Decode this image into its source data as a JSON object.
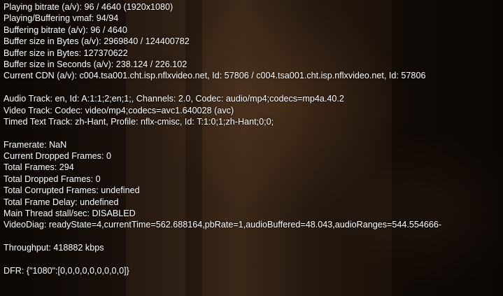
{
  "stats": {
    "playback": [
      "Playing bitrate (a/v): 96 / 4640 (1920x1080)",
      "Playing/Buffering vmaf: 94/94",
      "Buffering bitrate (a/v): 96 / 4640",
      "Buffer size in Bytes (a/v): 2969840 / 124400782",
      "Buffer size in Bytes: 127370622",
      "Buffer size in Seconds (a/v): 238.124 / 226.102",
      "Current CDN (a/v): c004.tsa001.cht.isp.nflxvideo.net, Id: 57806 / c004.tsa001.cht.isp.nflxvideo.net, Id: 57806"
    ],
    "tracks": [
      "Audio Track: en, Id: A:1:1;2;en;1;, Channels: 2.0, Codec: audio/mp4;codecs=mp4a.40.2",
      "Video Track: Codec: video/mp4;codecs=avc1.640028 (avc)",
      "Timed Text Track: zh-Hant, Profile: nflx-cmisc, Id: T:1:0;1;zh-Hant;0;0;"
    ],
    "frames": [
      "Framerate: NaN",
      "Current Dropped Frames: 0",
      "Total Frames: 294",
      "Total Dropped Frames: 0",
      "Total Corrupted Frames: undefined",
      "Total Frame Delay: undefined",
      "Main Thread stall/sec: DISABLED",
      "VideoDiag: readyState=4,currentTime=562.688164,pbRate=1,audioBuffered=48.043,audioRanges=544.554666-"
    ],
    "throughput": "Throughput: 418882 kbps",
    "dfr": "DFR: {\"1080\":[0,0,0,0,0,0,0,0,0]}"
  }
}
